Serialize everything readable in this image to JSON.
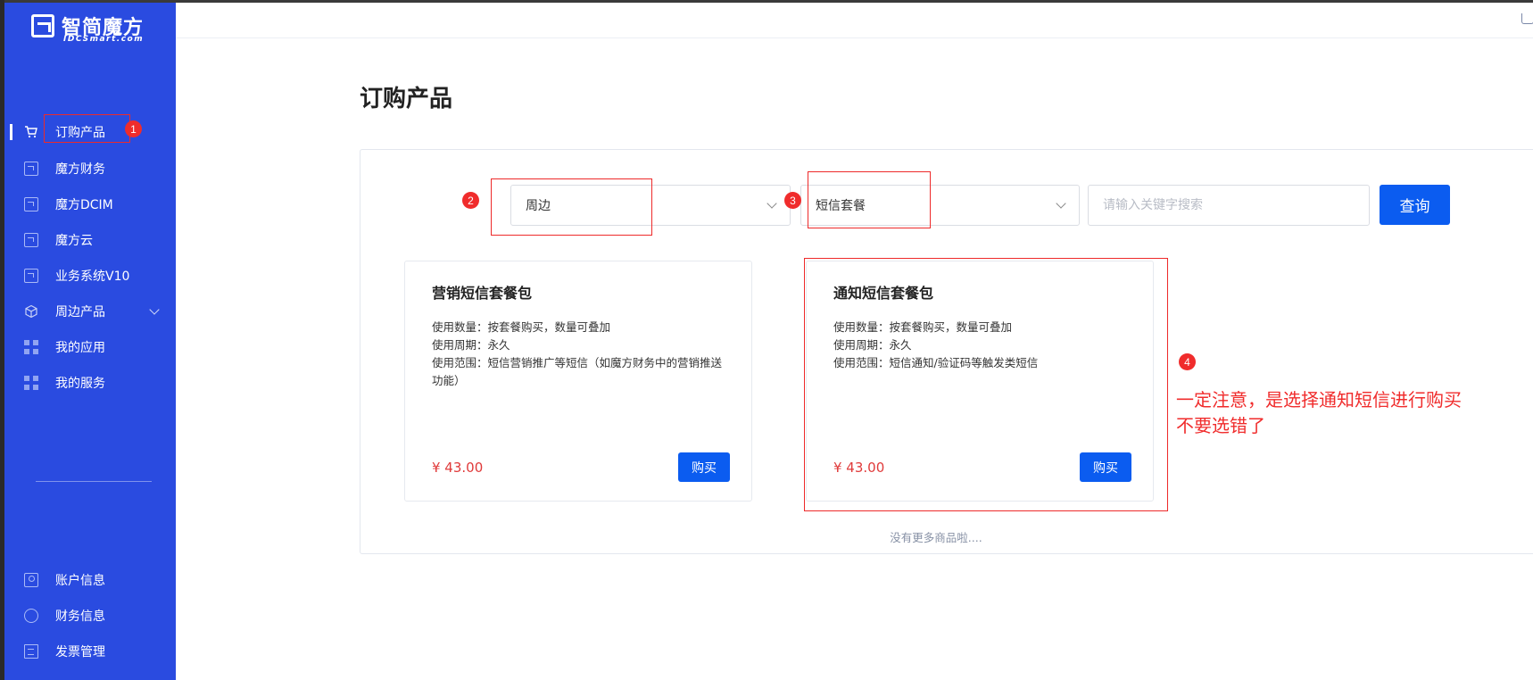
{
  "brand": {
    "name": "智简魔方",
    "sub": "IDCSmart.com"
  },
  "sidebar": {
    "items": [
      {
        "label": "订购产品",
        "icon": "cart-icon",
        "active": true
      },
      {
        "label": "魔方财务",
        "icon": "mofang-logo-icon"
      },
      {
        "label": "魔方DCIM",
        "icon": "mofang-logo-icon"
      },
      {
        "label": "魔方云",
        "icon": "mofang-logo-icon"
      },
      {
        "label": "业务系统V10",
        "icon": "mofang-logo-icon"
      },
      {
        "label": "周边产品",
        "icon": "cube-icon",
        "expandable": true
      },
      {
        "label": "我的应用",
        "icon": "grid-icon"
      },
      {
        "label": "我的服务",
        "icon": "grid-icon"
      }
    ],
    "bottom_items": [
      {
        "label": "账户信息",
        "icon": "user-icon"
      },
      {
        "label": "财务信息",
        "icon": "coin-icon"
      },
      {
        "label": "发票管理",
        "icon": "invoice-icon"
      }
    ]
  },
  "page": {
    "title": "订购产品"
  },
  "filters": {
    "category": "周边",
    "subcategory": "短信套餐",
    "search_placeholder": "请输入关键字搜索",
    "query_label": "查询"
  },
  "products": [
    {
      "title": "营销短信套餐包",
      "desc": [
        "使用数量：按套餐购买，数量可叠加",
        "使用周期：永久",
        "使用范围：短信营销推广等短信（如魔方财务中的营销推送功能）"
      ],
      "price": "¥ 43.00",
      "buy_label": "购买"
    },
    {
      "title": "通知短信套餐包",
      "desc": [
        "使用数量：按套餐购买，数量可叠加",
        "使用周期：永久",
        "使用范围：短信通知/验证码等触发类短信"
      ],
      "price": "¥ 43.00",
      "buy_label": "购买"
    }
  ],
  "no_more": "没有更多商品啦....",
  "annotations": {
    "steps": [
      "1",
      "2",
      "3",
      "4"
    ],
    "note_line1": "一定注意，是选择通知短信进行购买",
    "note_line2": "不要选错了",
    "color": "#f02c2c"
  },
  "colors": {
    "sidebar": "#2a4be0",
    "primary": "#0b5cf0",
    "price": "#e03a3a"
  }
}
